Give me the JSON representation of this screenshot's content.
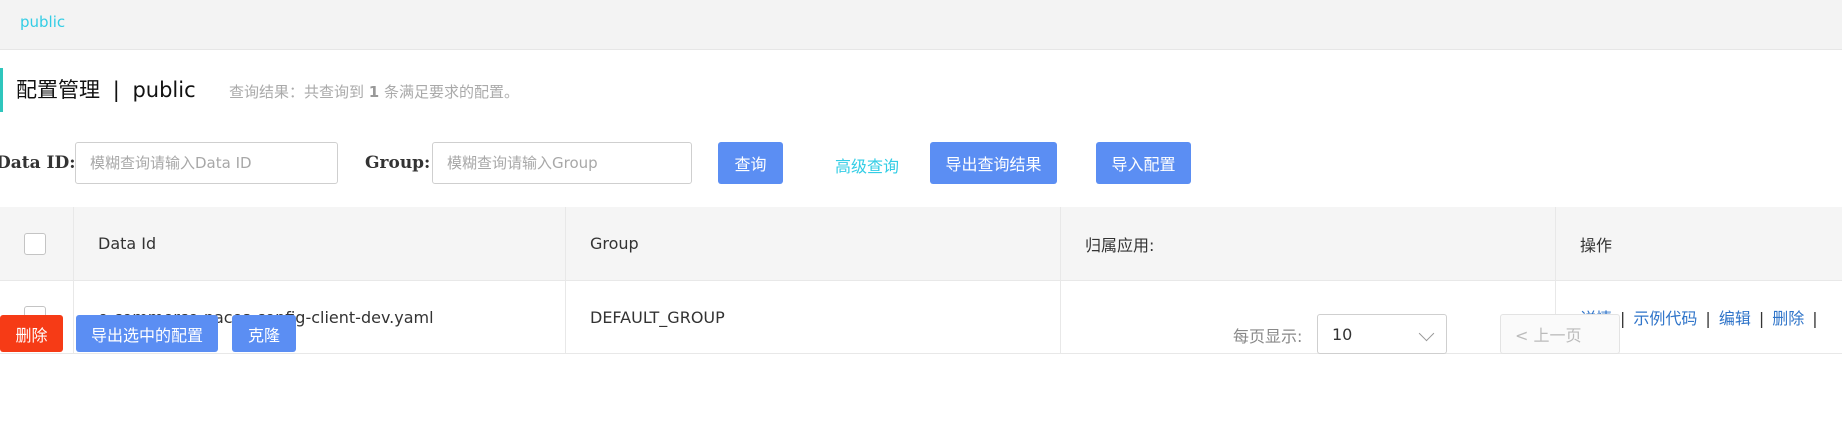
{
  "namespace": {
    "link": "public"
  },
  "header": {
    "title": "配置管理",
    "separator": "|",
    "namespace": "public",
    "summary_prefix": "查询结果：共查询到",
    "summary_count": "1",
    "summary_suffix": "条满足要求的配置。"
  },
  "search": {
    "data_id_label": "Data ID:",
    "data_id_placeholder": "模糊查询请输入Data ID",
    "group_label": "Group:",
    "group_placeholder": "模糊查询请输入Group",
    "query_button": "查询",
    "advanced_link": "高级查询",
    "export_button": "导出查询结果",
    "import_button": "导入配置"
  },
  "table": {
    "headers": [
      "Data Id",
      "Group",
      "归属应用:",
      "操作"
    ],
    "rows": [
      {
        "data_id": "e-commerce-nacos-config-client-dev.yaml",
        "group": "DEFAULT_GROUP",
        "app": ""
      }
    ],
    "actions": [
      "详情",
      "示例代码",
      "编辑",
      "删除"
    ],
    "action_separator": "|"
  },
  "footer": {
    "delete_button": "删除",
    "export_selected_button": "导出选中的配置",
    "clone_button": "克隆",
    "page_size_label": "每页显示:",
    "page_size_value": "10",
    "prev_page": "< 上一页"
  },
  "colors": {
    "primary": "#5b8ef3",
    "danger": "#f63b16",
    "accent": "#33cde5",
    "title_mark": "#2fc6bd"
  }
}
